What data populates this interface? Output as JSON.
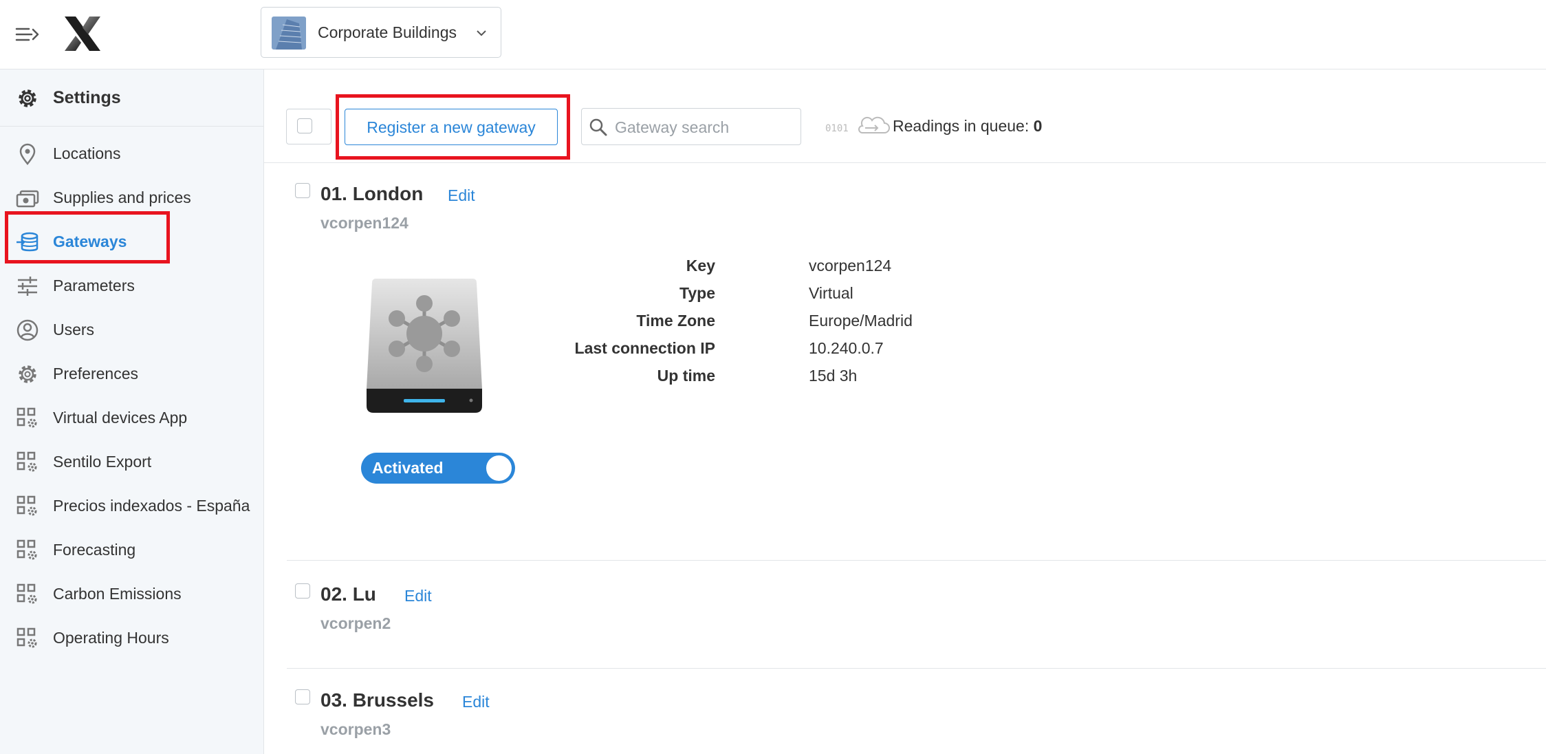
{
  "location_selector": {
    "name": "Corporate Buildings"
  },
  "sidebar": {
    "header": "Settings",
    "items": [
      {
        "label": "Locations",
        "icon": "map-pin-icon"
      },
      {
        "label": "Supplies and prices",
        "icon": "money-icon"
      },
      {
        "label": "Gateways",
        "icon": "gateway-icon",
        "active": true
      },
      {
        "label": "Parameters",
        "icon": "sliders-icon"
      },
      {
        "label": "Users",
        "icon": "user-circle-icon"
      },
      {
        "label": "Preferences",
        "icon": "gear-icon"
      },
      {
        "label": "Virtual devices App",
        "icon": "app-grid-gear-icon"
      },
      {
        "label": "Sentilo Export",
        "icon": "app-grid-gear-icon"
      },
      {
        "label": "Precios indexados - España",
        "icon": "app-grid-gear-icon"
      },
      {
        "label": "Forecasting",
        "icon": "app-grid-gear-icon"
      },
      {
        "label": "Carbon Emissions",
        "icon": "app-grid-gear-icon"
      },
      {
        "label": "Operating Hours",
        "icon": "app-grid-gear-icon"
      }
    ]
  },
  "toolbar": {
    "register_label": "Register a new gateway",
    "search_placeholder": "Gateway search",
    "queue_prefix": "0101",
    "queue_label": "Readings in queue:",
    "queue_count": "0"
  },
  "gateways": [
    {
      "title": "01. London",
      "edit": "Edit",
      "key": "vcorpen124",
      "details": [
        {
          "label": "Key",
          "value": "vcorpen124"
        },
        {
          "label": "Type",
          "value": "Virtual"
        },
        {
          "label": "Time Zone",
          "value": "Europe/Madrid"
        },
        {
          "label": "Last connection IP",
          "value": "10.240.0.7"
        },
        {
          "label": "Up time",
          "value": "15d 3h"
        }
      ],
      "status": "Activated"
    },
    {
      "title": "02. Lu",
      "edit": "Edit",
      "key": "vcorpen2"
    },
    {
      "title": "03. Brussels",
      "edit": "Edit",
      "key": "vcorpen3"
    }
  ],
  "colors": {
    "accent": "#2b86d8",
    "highlight": "#e8141f",
    "sidebar_bg": "#f4f7fa"
  }
}
